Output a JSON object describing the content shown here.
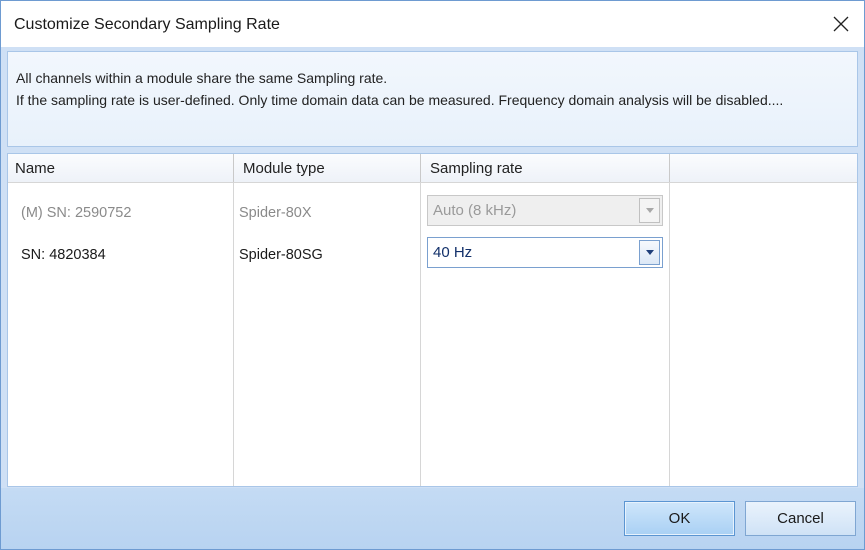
{
  "window": {
    "title": "Customize Secondary Sampling Rate"
  },
  "info": {
    "line1": "All channels within a module share the same Sampling rate.",
    "line2": "If the sampling rate is user-defined. Only time domain data can be measured. Frequency domain analysis will be disabled...."
  },
  "grid": {
    "columns": [
      "Name",
      "Module type",
      "Sampling rate"
    ],
    "rows": [
      {
        "name": "(M) SN: 2590752",
        "module_type": "Spider-80X",
        "sampling_rate": "Auto (8 kHz)",
        "enabled": false
      },
      {
        "name": "SN: 4820384",
        "module_type": "Spider-80SG",
        "sampling_rate": "40 Hz",
        "enabled": true
      }
    ]
  },
  "buttons": {
    "ok": "OK",
    "cancel": "Cancel"
  },
  "colors": {
    "accent": "#3a75c4",
    "footer": "#bcd6f2"
  }
}
